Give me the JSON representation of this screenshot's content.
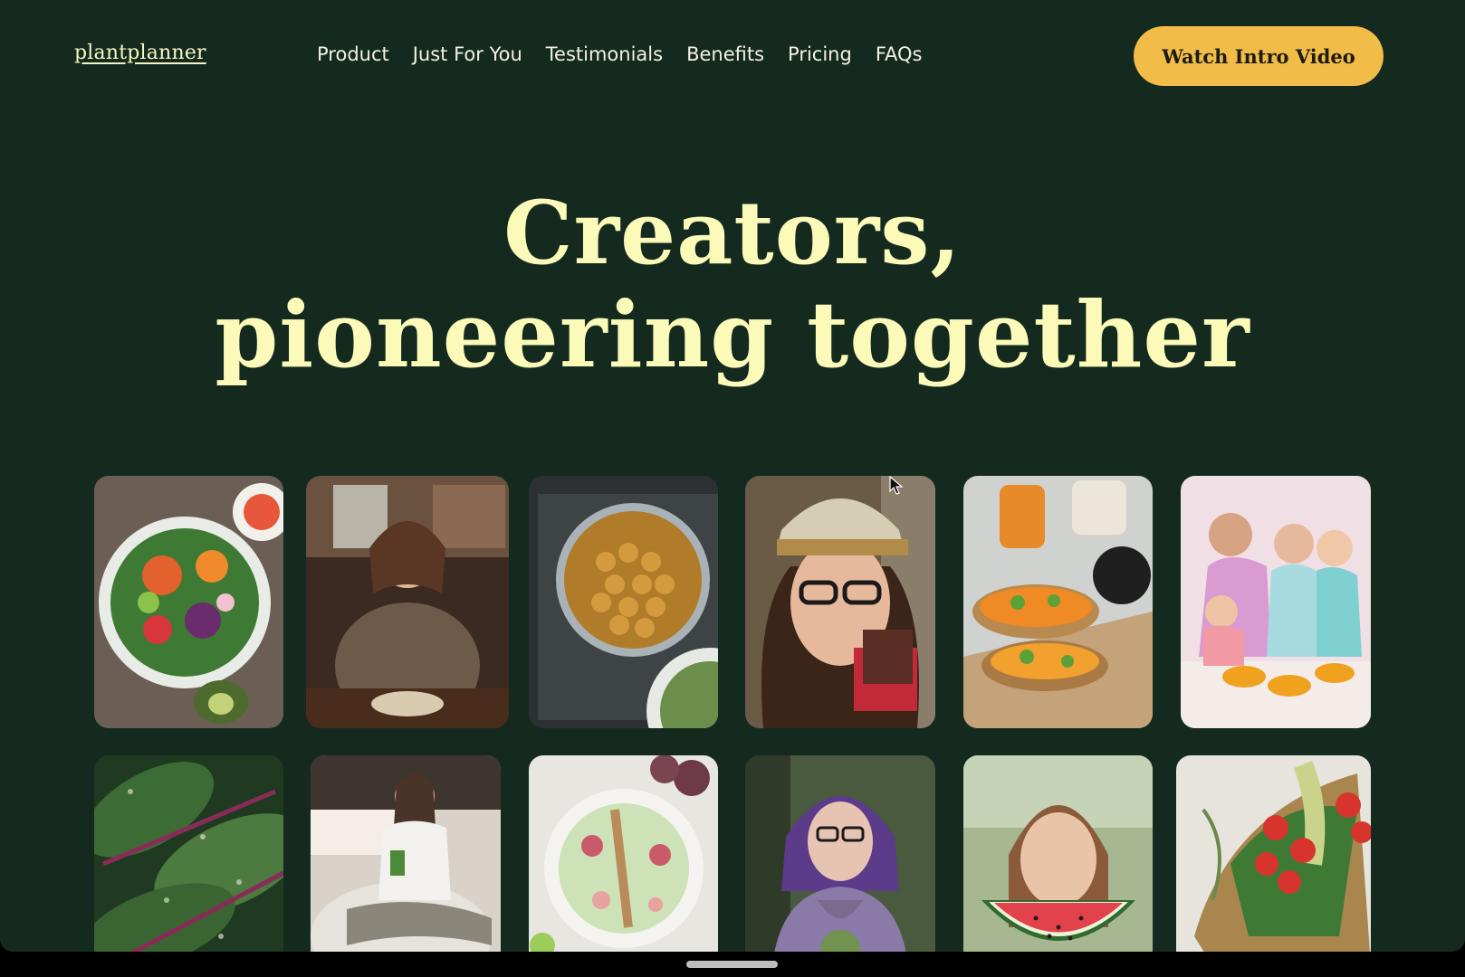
{
  "brand": {
    "logo_text": "plantplanner"
  },
  "nav": {
    "items": [
      {
        "label": "Product"
      },
      {
        "label": "Just For You"
      },
      {
        "label": "Testimonials"
      },
      {
        "label": "Benefits"
      },
      {
        "label": "Pricing"
      },
      {
        "label": "FAQs"
      }
    ]
  },
  "header": {
    "cta_label": "Watch Intro Video"
  },
  "hero": {
    "line1": "Creators,",
    "line2": "pioneering together"
  },
  "gallery": {
    "tiles": [
      {
        "subject": "salad-bowl-photo"
      },
      {
        "subject": "woman-cooking-photo"
      },
      {
        "subject": "roasted-chickpeas-photo"
      },
      {
        "subject": "woman-in-cap-selfie-photo"
      },
      {
        "subject": "carrot-toast-photo"
      },
      {
        "subject": "family-meal-photo"
      },
      {
        "subject": "chard-leaves-photo"
      },
      {
        "subject": "woman-with-green-juice-photo"
      },
      {
        "subject": "fig-smoothie-bowl-photo"
      },
      {
        "subject": "purple-hair-woman-photo"
      },
      {
        "subject": "watermelon-girl-photo"
      },
      {
        "subject": "tomato-vegetables-photo"
      }
    ]
  },
  "colors": {
    "background": "#142a1f",
    "hero_text": "#fbfab9",
    "cta": "#f1bd48",
    "nav_text": "#f4f1e4"
  }
}
